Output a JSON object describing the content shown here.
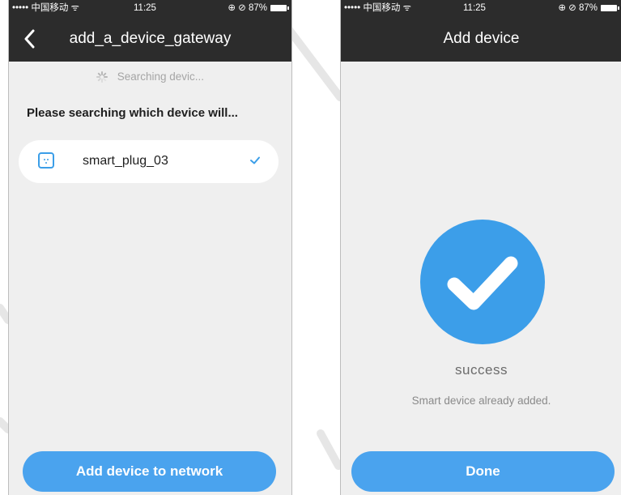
{
  "left_screen": {
    "status_bar": {
      "carrier": "••••• 中国移动 ᯤ",
      "time": "11:25",
      "right": "⊕ ⊘ 87%"
    },
    "nav_title": "add_a_device_gateway",
    "searching_text": "Searching devic...",
    "prompt": "Please searching which device will...",
    "device": {
      "name": "smart_plug_03",
      "selected": true
    },
    "button_label": "Add device to network"
  },
  "right_screen": {
    "status_bar": {
      "carrier": "••••• 中国移动 ᯤ",
      "time": "11:25",
      "right": "⊕ ⊘ 87%"
    },
    "nav_title": "Add device",
    "success_title": "success",
    "success_message": "Smart device already added.",
    "button_label": "Done"
  },
  "colors": {
    "accent": "#4aa3ee",
    "nav_bg": "#2c2c2c",
    "screen_bg": "#efefef"
  }
}
